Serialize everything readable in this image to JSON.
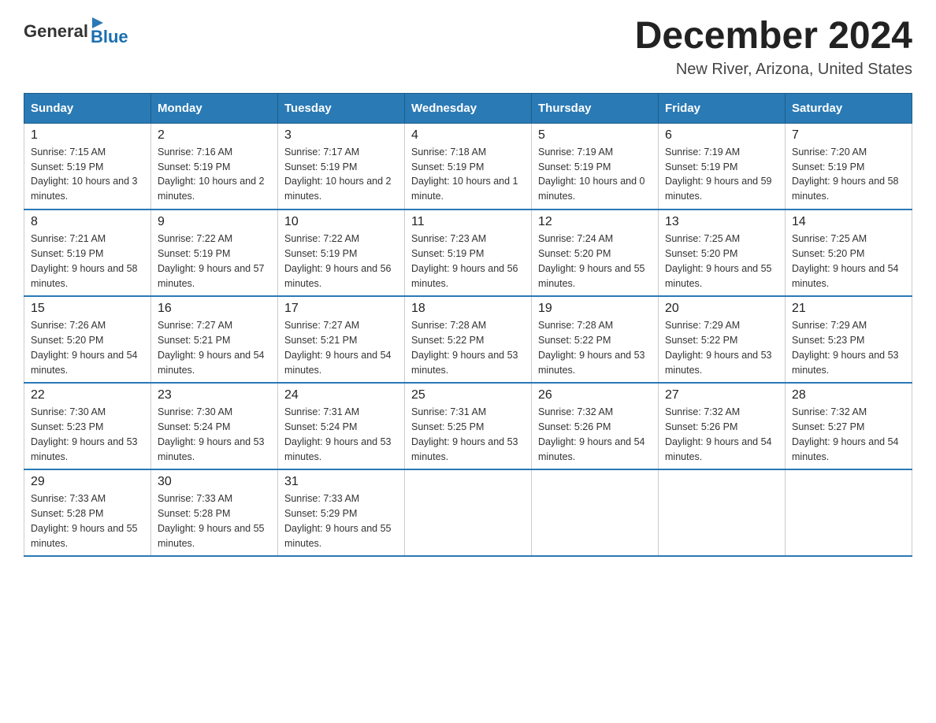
{
  "header": {
    "logo_general": "General",
    "logo_blue": "Blue",
    "month_title": "December 2024",
    "location": "New River, Arizona, United States"
  },
  "days_of_week": [
    "Sunday",
    "Monday",
    "Tuesday",
    "Wednesday",
    "Thursday",
    "Friday",
    "Saturday"
  ],
  "weeks": [
    [
      {
        "day": "1",
        "sunrise": "7:15 AM",
        "sunset": "5:19 PM",
        "daylight": "10 hours and 3 minutes."
      },
      {
        "day": "2",
        "sunrise": "7:16 AM",
        "sunset": "5:19 PM",
        "daylight": "10 hours and 2 minutes."
      },
      {
        "day": "3",
        "sunrise": "7:17 AM",
        "sunset": "5:19 PM",
        "daylight": "10 hours and 2 minutes."
      },
      {
        "day": "4",
        "sunrise": "7:18 AM",
        "sunset": "5:19 PM",
        "daylight": "10 hours and 1 minute."
      },
      {
        "day": "5",
        "sunrise": "7:19 AM",
        "sunset": "5:19 PM",
        "daylight": "10 hours and 0 minutes."
      },
      {
        "day": "6",
        "sunrise": "7:19 AM",
        "sunset": "5:19 PM",
        "daylight": "9 hours and 59 minutes."
      },
      {
        "day": "7",
        "sunrise": "7:20 AM",
        "sunset": "5:19 PM",
        "daylight": "9 hours and 58 minutes."
      }
    ],
    [
      {
        "day": "8",
        "sunrise": "7:21 AM",
        "sunset": "5:19 PM",
        "daylight": "9 hours and 58 minutes."
      },
      {
        "day": "9",
        "sunrise": "7:22 AM",
        "sunset": "5:19 PM",
        "daylight": "9 hours and 57 minutes."
      },
      {
        "day": "10",
        "sunrise": "7:22 AM",
        "sunset": "5:19 PM",
        "daylight": "9 hours and 56 minutes."
      },
      {
        "day": "11",
        "sunrise": "7:23 AM",
        "sunset": "5:19 PM",
        "daylight": "9 hours and 56 minutes."
      },
      {
        "day": "12",
        "sunrise": "7:24 AM",
        "sunset": "5:20 PM",
        "daylight": "9 hours and 55 minutes."
      },
      {
        "day": "13",
        "sunrise": "7:25 AM",
        "sunset": "5:20 PM",
        "daylight": "9 hours and 55 minutes."
      },
      {
        "day": "14",
        "sunrise": "7:25 AM",
        "sunset": "5:20 PM",
        "daylight": "9 hours and 54 minutes."
      }
    ],
    [
      {
        "day": "15",
        "sunrise": "7:26 AM",
        "sunset": "5:20 PM",
        "daylight": "9 hours and 54 minutes."
      },
      {
        "day": "16",
        "sunrise": "7:27 AM",
        "sunset": "5:21 PM",
        "daylight": "9 hours and 54 minutes."
      },
      {
        "day": "17",
        "sunrise": "7:27 AM",
        "sunset": "5:21 PM",
        "daylight": "9 hours and 54 minutes."
      },
      {
        "day": "18",
        "sunrise": "7:28 AM",
        "sunset": "5:22 PM",
        "daylight": "9 hours and 53 minutes."
      },
      {
        "day": "19",
        "sunrise": "7:28 AM",
        "sunset": "5:22 PM",
        "daylight": "9 hours and 53 minutes."
      },
      {
        "day": "20",
        "sunrise": "7:29 AM",
        "sunset": "5:22 PM",
        "daylight": "9 hours and 53 minutes."
      },
      {
        "day": "21",
        "sunrise": "7:29 AM",
        "sunset": "5:23 PM",
        "daylight": "9 hours and 53 minutes."
      }
    ],
    [
      {
        "day": "22",
        "sunrise": "7:30 AM",
        "sunset": "5:23 PM",
        "daylight": "9 hours and 53 minutes."
      },
      {
        "day": "23",
        "sunrise": "7:30 AM",
        "sunset": "5:24 PM",
        "daylight": "9 hours and 53 minutes."
      },
      {
        "day": "24",
        "sunrise": "7:31 AM",
        "sunset": "5:24 PM",
        "daylight": "9 hours and 53 minutes."
      },
      {
        "day": "25",
        "sunrise": "7:31 AM",
        "sunset": "5:25 PM",
        "daylight": "9 hours and 53 minutes."
      },
      {
        "day": "26",
        "sunrise": "7:32 AM",
        "sunset": "5:26 PM",
        "daylight": "9 hours and 54 minutes."
      },
      {
        "day": "27",
        "sunrise": "7:32 AM",
        "sunset": "5:26 PM",
        "daylight": "9 hours and 54 minutes."
      },
      {
        "day": "28",
        "sunrise": "7:32 AM",
        "sunset": "5:27 PM",
        "daylight": "9 hours and 54 minutes."
      }
    ],
    [
      {
        "day": "29",
        "sunrise": "7:33 AM",
        "sunset": "5:28 PM",
        "daylight": "9 hours and 55 minutes."
      },
      {
        "day": "30",
        "sunrise": "7:33 AM",
        "sunset": "5:28 PM",
        "daylight": "9 hours and 55 minutes."
      },
      {
        "day": "31",
        "sunrise": "7:33 AM",
        "sunset": "5:29 PM",
        "daylight": "9 hours and 55 minutes."
      },
      null,
      null,
      null,
      null
    ]
  ]
}
